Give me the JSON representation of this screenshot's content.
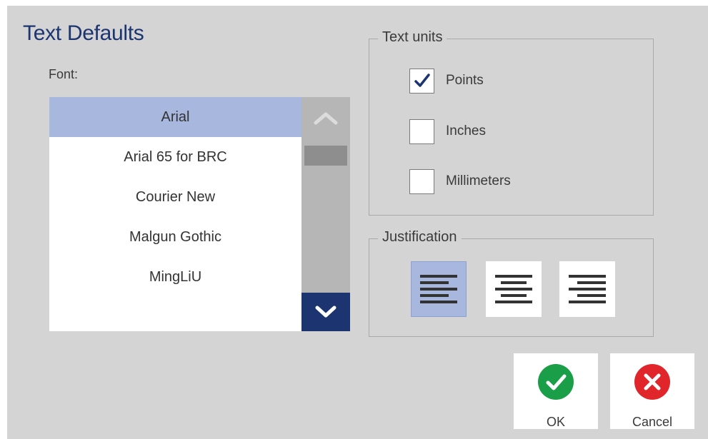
{
  "dialog": {
    "title": "Text Defaults"
  },
  "font": {
    "label": "Font:",
    "items": [
      "Arial",
      "Arial 65 for BRC",
      "Courier New",
      "Malgun Gothic",
      "MingLiU"
    ],
    "selected": "Arial",
    "scroll_up_icon": "chevron-up-icon",
    "scroll_down_icon": "chevron-down-icon"
  },
  "text_units": {
    "legend": "Text units",
    "options": [
      {
        "label": "Points",
        "checked": true
      },
      {
        "label": "Inches",
        "checked": false
      },
      {
        "label": "Millimeters",
        "checked": false
      }
    ]
  },
  "justification": {
    "legend": "Justification",
    "options": [
      {
        "icon": "align-left-icon",
        "selected": true
      },
      {
        "icon": "align-center-icon",
        "selected": false
      },
      {
        "icon": "align-right-icon",
        "selected": false
      }
    ]
  },
  "buttons": {
    "ok_label": "OK",
    "ok_icon": "checkmark-icon",
    "cancel_label": "Cancel",
    "cancel_icon": "close-icon"
  },
  "colors": {
    "title": "#1c3470",
    "selection": "#a7b7de",
    "scroll_down": "#1c3470",
    "ok": "#1a9e47",
    "cancel": "#e0262b",
    "background": "#d4d4d4"
  }
}
